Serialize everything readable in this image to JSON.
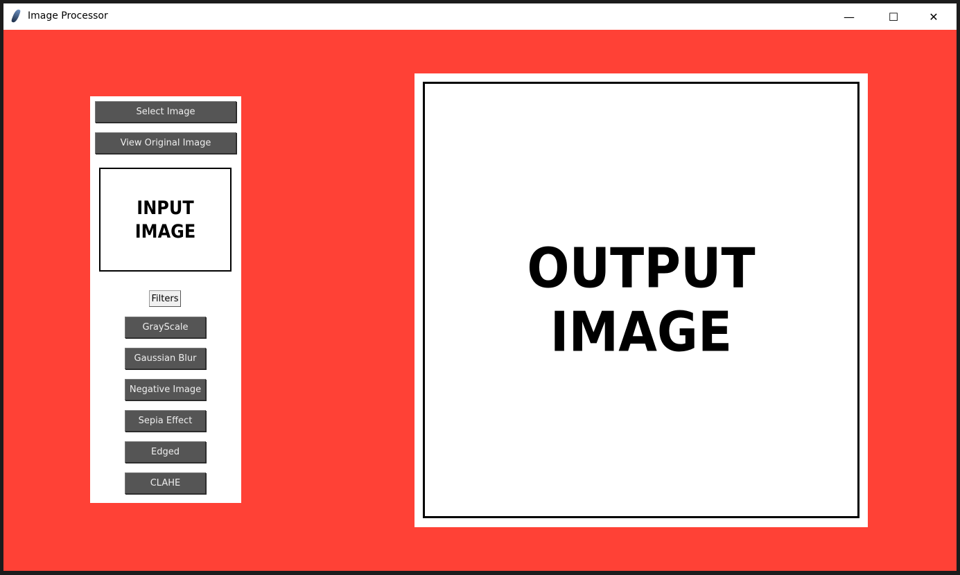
{
  "window": {
    "title": "Image Processor",
    "minimize": "—",
    "maximize": "☐",
    "close": "✕"
  },
  "left_panel": {
    "select_image": "Select Image",
    "view_original": "View Original Image",
    "input_placeholder": [
      "INPUT",
      "IMAGE"
    ],
    "filters_label": "Filters",
    "filters": [
      "GrayScale",
      "Gaussian Blur",
      "Negative Image",
      "Sepia Effect",
      "Edged",
      "CLAHE"
    ]
  },
  "output": {
    "placeholder": [
      "OUTPUT",
      "IMAGE"
    ]
  },
  "colors": {
    "background": "#ff4136",
    "button": "#555555"
  }
}
